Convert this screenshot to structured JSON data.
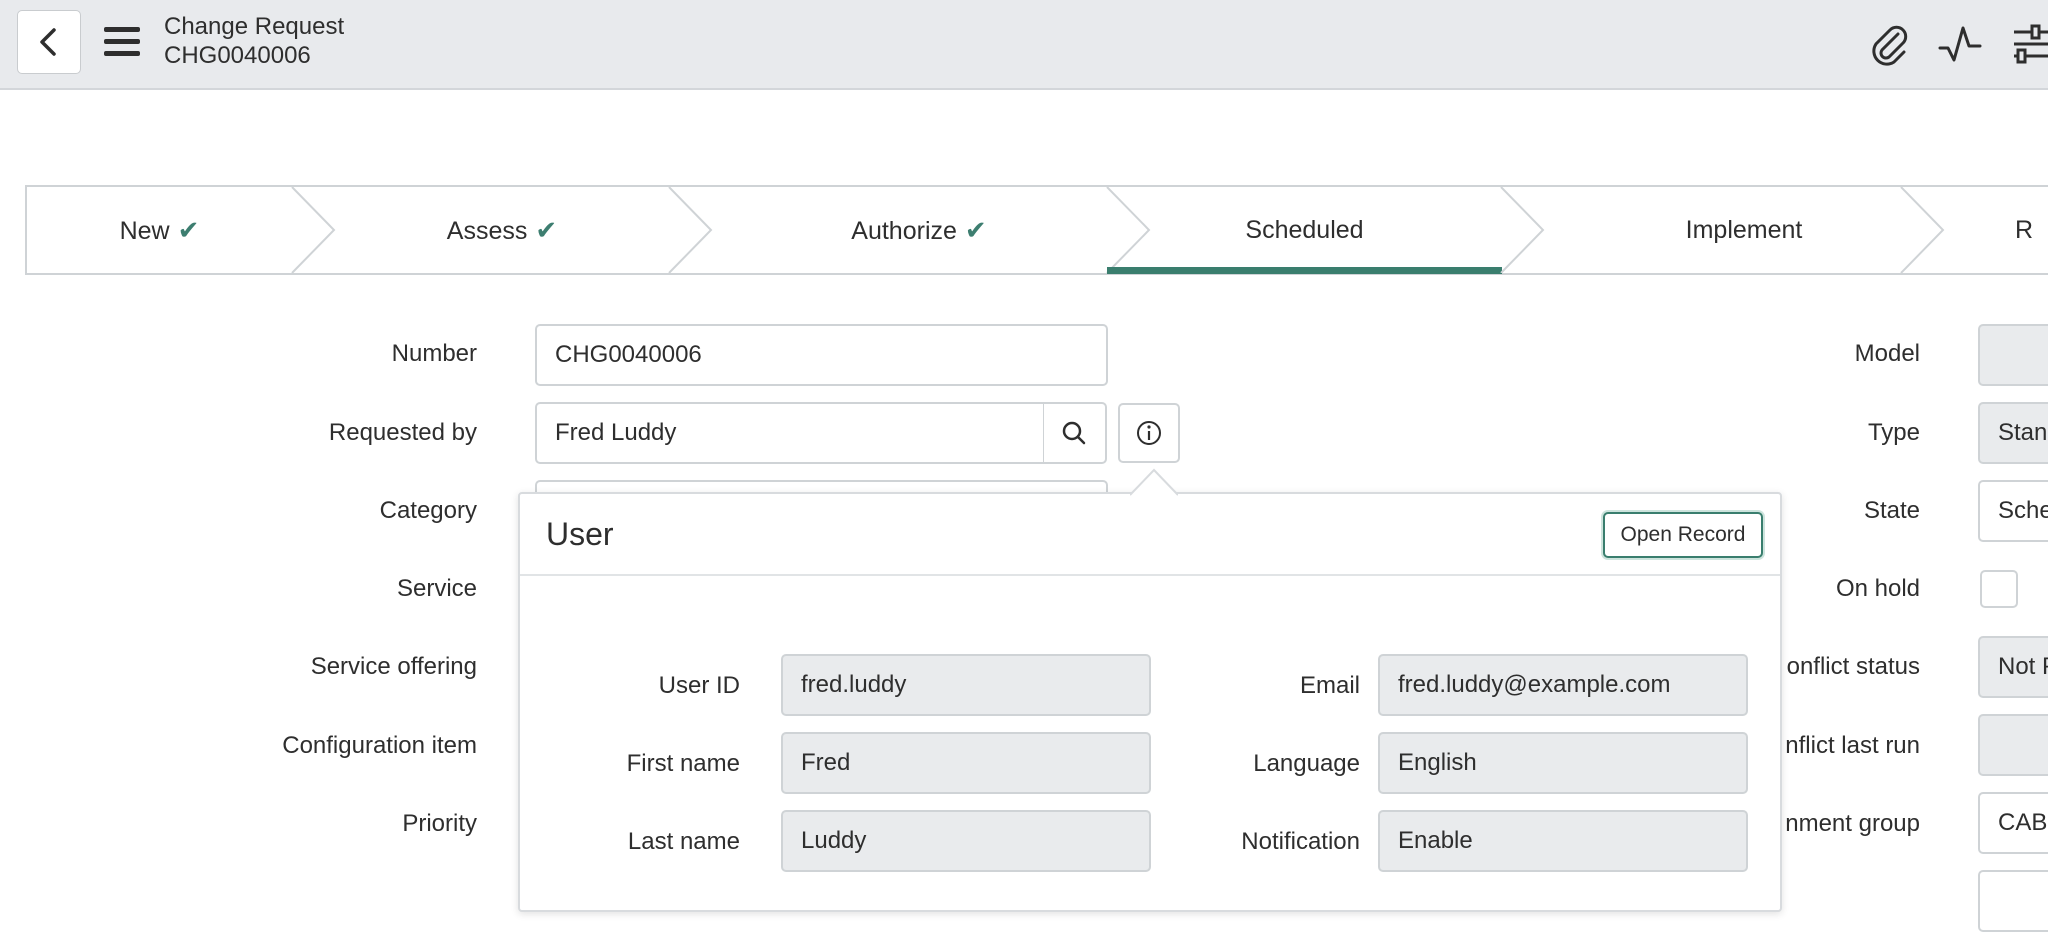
{
  "header": {
    "title": "Change Request",
    "number": "CHG0040006"
  },
  "stages": [
    {
      "label": "New",
      "completed": true
    },
    {
      "label": "Assess",
      "completed": true
    },
    {
      "label": "Authorize",
      "completed": true
    },
    {
      "label": "Scheduled",
      "completed": false,
      "active": true
    },
    {
      "label": "Implement",
      "completed": false
    },
    {
      "label": "R",
      "completed": false
    }
  ],
  "check_glyph": "✔",
  "form_left": {
    "number_label": "Number",
    "number_value": "CHG0040006",
    "requested_by_label": "Requested by",
    "requested_by_value": "Fred Luddy",
    "category_label": "Category",
    "service_label": "Service",
    "service_offering_label": "Service offering",
    "configuration_item_label": "Configuration item",
    "priority_label": "Priority"
  },
  "form_right": {
    "model_label": "Model",
    "type_label": "Type",
    "type_value": "Standa",
    "state_label": "State",
    "state_value": "Sche",
    "on_hold_label": "On hold",
    "conflict_status_label": "onflict status",
    "conflict_status_value": "Not P",
    "conflict_last_run_label": "nflict last run",
    "assignment_group_label": "nment group",
    "assignment_group_value": "CAB A"
  },
  "popup": {
    "title": "User",
    "open_record_label": "Open Record",
    "user_id_label": "User ID",
    "user_id_value": "fred.luddy",
    "first_name_label": "First name",
    "first_name_value": "Fred",
    "last_name_label": "Last name",
    "last_name_value": "Luddy",
    "email_label": "Email",
    "email_value": "fred.luddy@example.com",
    "language_label": "Language",
    "language_value": "English",
    "notification_label": "Notification",
    "notification_value": "Enable"
  },
  "colors": {
    "header_bg": "#e8eaed",
    "accent": "#3a7e6e",
    "check": "#3d7e70",
    "readonly_field": "#e9ebed",
    "border": "#cfd3d6"
  },
  "icons": {
    "back": "chevron-left-icon",
    "menu": "hamburger-menu-icon",
    "attachment": "paperclip-icon",
    "activity": "activity-pulse-icon",
    "settings": "sliders-icon",
    "search": "search-icon",
    "info": "info-icon"
  }
}
